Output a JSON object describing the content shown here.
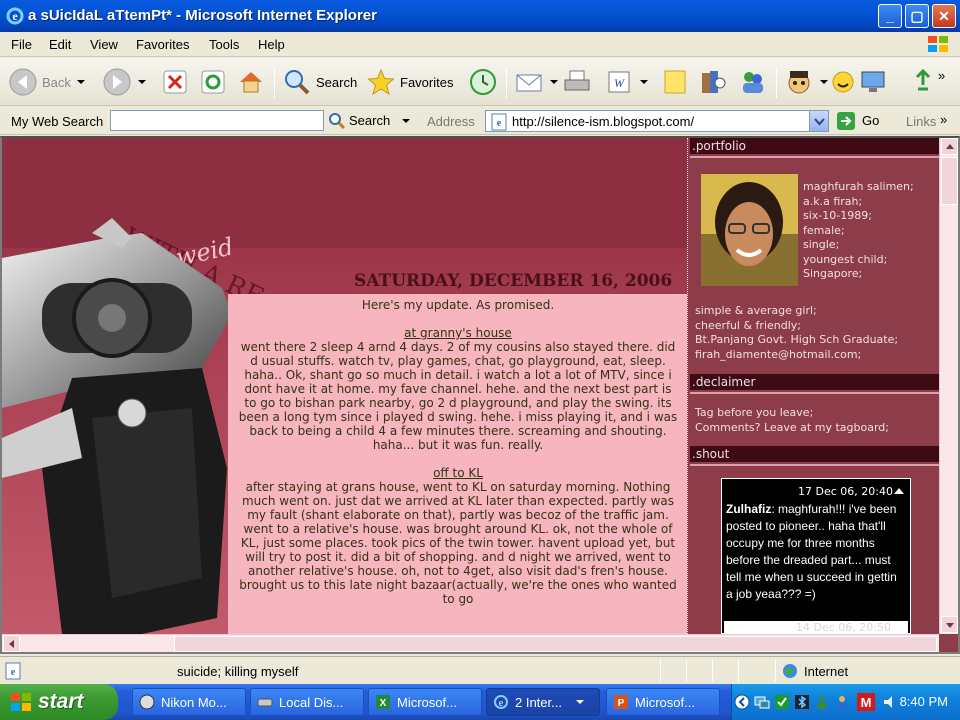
{
  "window": {
    "title": "a sUicIdaL aTtemPt* - Microsoft Internet Explorer"
  },
  "menu": [
    "File",
    "Edit",
    "View",
    "Favorites",
    "Tools",
    "Help"
  ],
  "toolbar": {
    "back": "Back",
    "search": "Search",
    "favorites": "Favorites"
  },
  "addressbar": {
    "websearch_label": "My Web Search",
    "websearch_value": "",
    "search_btn": "Search",
    "address_label": "Address",
    "url": "http://silence-ism.blogspot.com/",
    "go": "Go",
    "links": "Links"
  },
  "blog": {
    "header_script": "weid",
    "header_text": "WITH A RE",
    "post_date": "SATURDAY, DECEMBER 16, 2006",
    "post_intro": "Here's my update. As promised.",
    "section1_title": "at granny's house",
    "section1_body": "went there 2 sleep 4 arnd 4 days. 2 of my cousins also stayed there. did d usual stuffs. watch tv, play games, chat, go playground, eat, sleep. haha.. Ok, shant go so much in detail. i watch a lot a lot of MTV, since i dont have it at home. my fave channel. hehe. and the next best part is to go to bishan park nearby, go 2 d playground, and play the swing. its been a long tym since i played d swing. hehe. i miss playing it, and i was back to being a child 4 a few minutes there. screaming and shouting. haha... but it was fun. really.",
    "section2_title": "off to KL",
    "section2_body": "after staying at grans house, went to KL on saturday morning. Nothing much went on. just dat we arrived at KL later than expected. partly was my fault (shant elaborate on that), partly was becoz of the traffic jam. went to a relative's house. was brought around KL. ok, not the whole of KL, just some places. took pics of the twin tower. havent upload yet, but will try to post it. did a bit of shopping. and d night we arrived, went to another relative's house. oh, not to 4get, also visit dad's fren's house. brought us to this late night bazaar(actually, we're the ones who wanted to go"
  },
  "sidebar": {
    "portfolio_head": ".portfolio",
    "profile_lines": [
      "maghfurah salimen;",
      "a.k.a firah;",
      "six-10-1989;",
      "female;",
      "single;",
      "youngest child;",
      "Singapore;"
    ],
    "profile_extra": [
      "simple & average girl;",
      "cheerful & friendly;",
      "Bt.Panjang Govt. High Sch Graduate;",
      "firah_diamente@hotmail.com;"
    ],
    "disclaimer_head": ".declaimer",
    "disclaimer_lines": [
      "Tag before you leave;",
      "Comments? Leave at my tagboard;"
    ],
    "shout_head": ".shout",
    "shout_date": "17 Dec 06, 20:40",
    "shout_name": "Zulhafiz",
    "shout_text": ": maghfurah!!! i've been posted to pioneer.. haha that'll occupy me for three months before the dreaded part... must tell me when u succeed in gettin a job yeaa??? =)",
    "shout_next_date": "14 Dec 06, 20:50"
  },
  "status": {
    "text": "suicide; killing myself",
    "zone": "Internet"
  },
  "taskbar": {
    "start": "start",
    "tasks": [
      "Nikon Mo...",
      "Local Dis...",
      "Microsof...",
      "2 Inter...",
      "Microsof..."
    ],
    "clock": "8:40 PM"
  },
  "colors": {
    "page_bg": "#8d2f40",
    "post_bg": "#f6b5bf",
    "sidebar_head": "#3e0a14",
    "xp_blue": "#0454d4"
  }
}
